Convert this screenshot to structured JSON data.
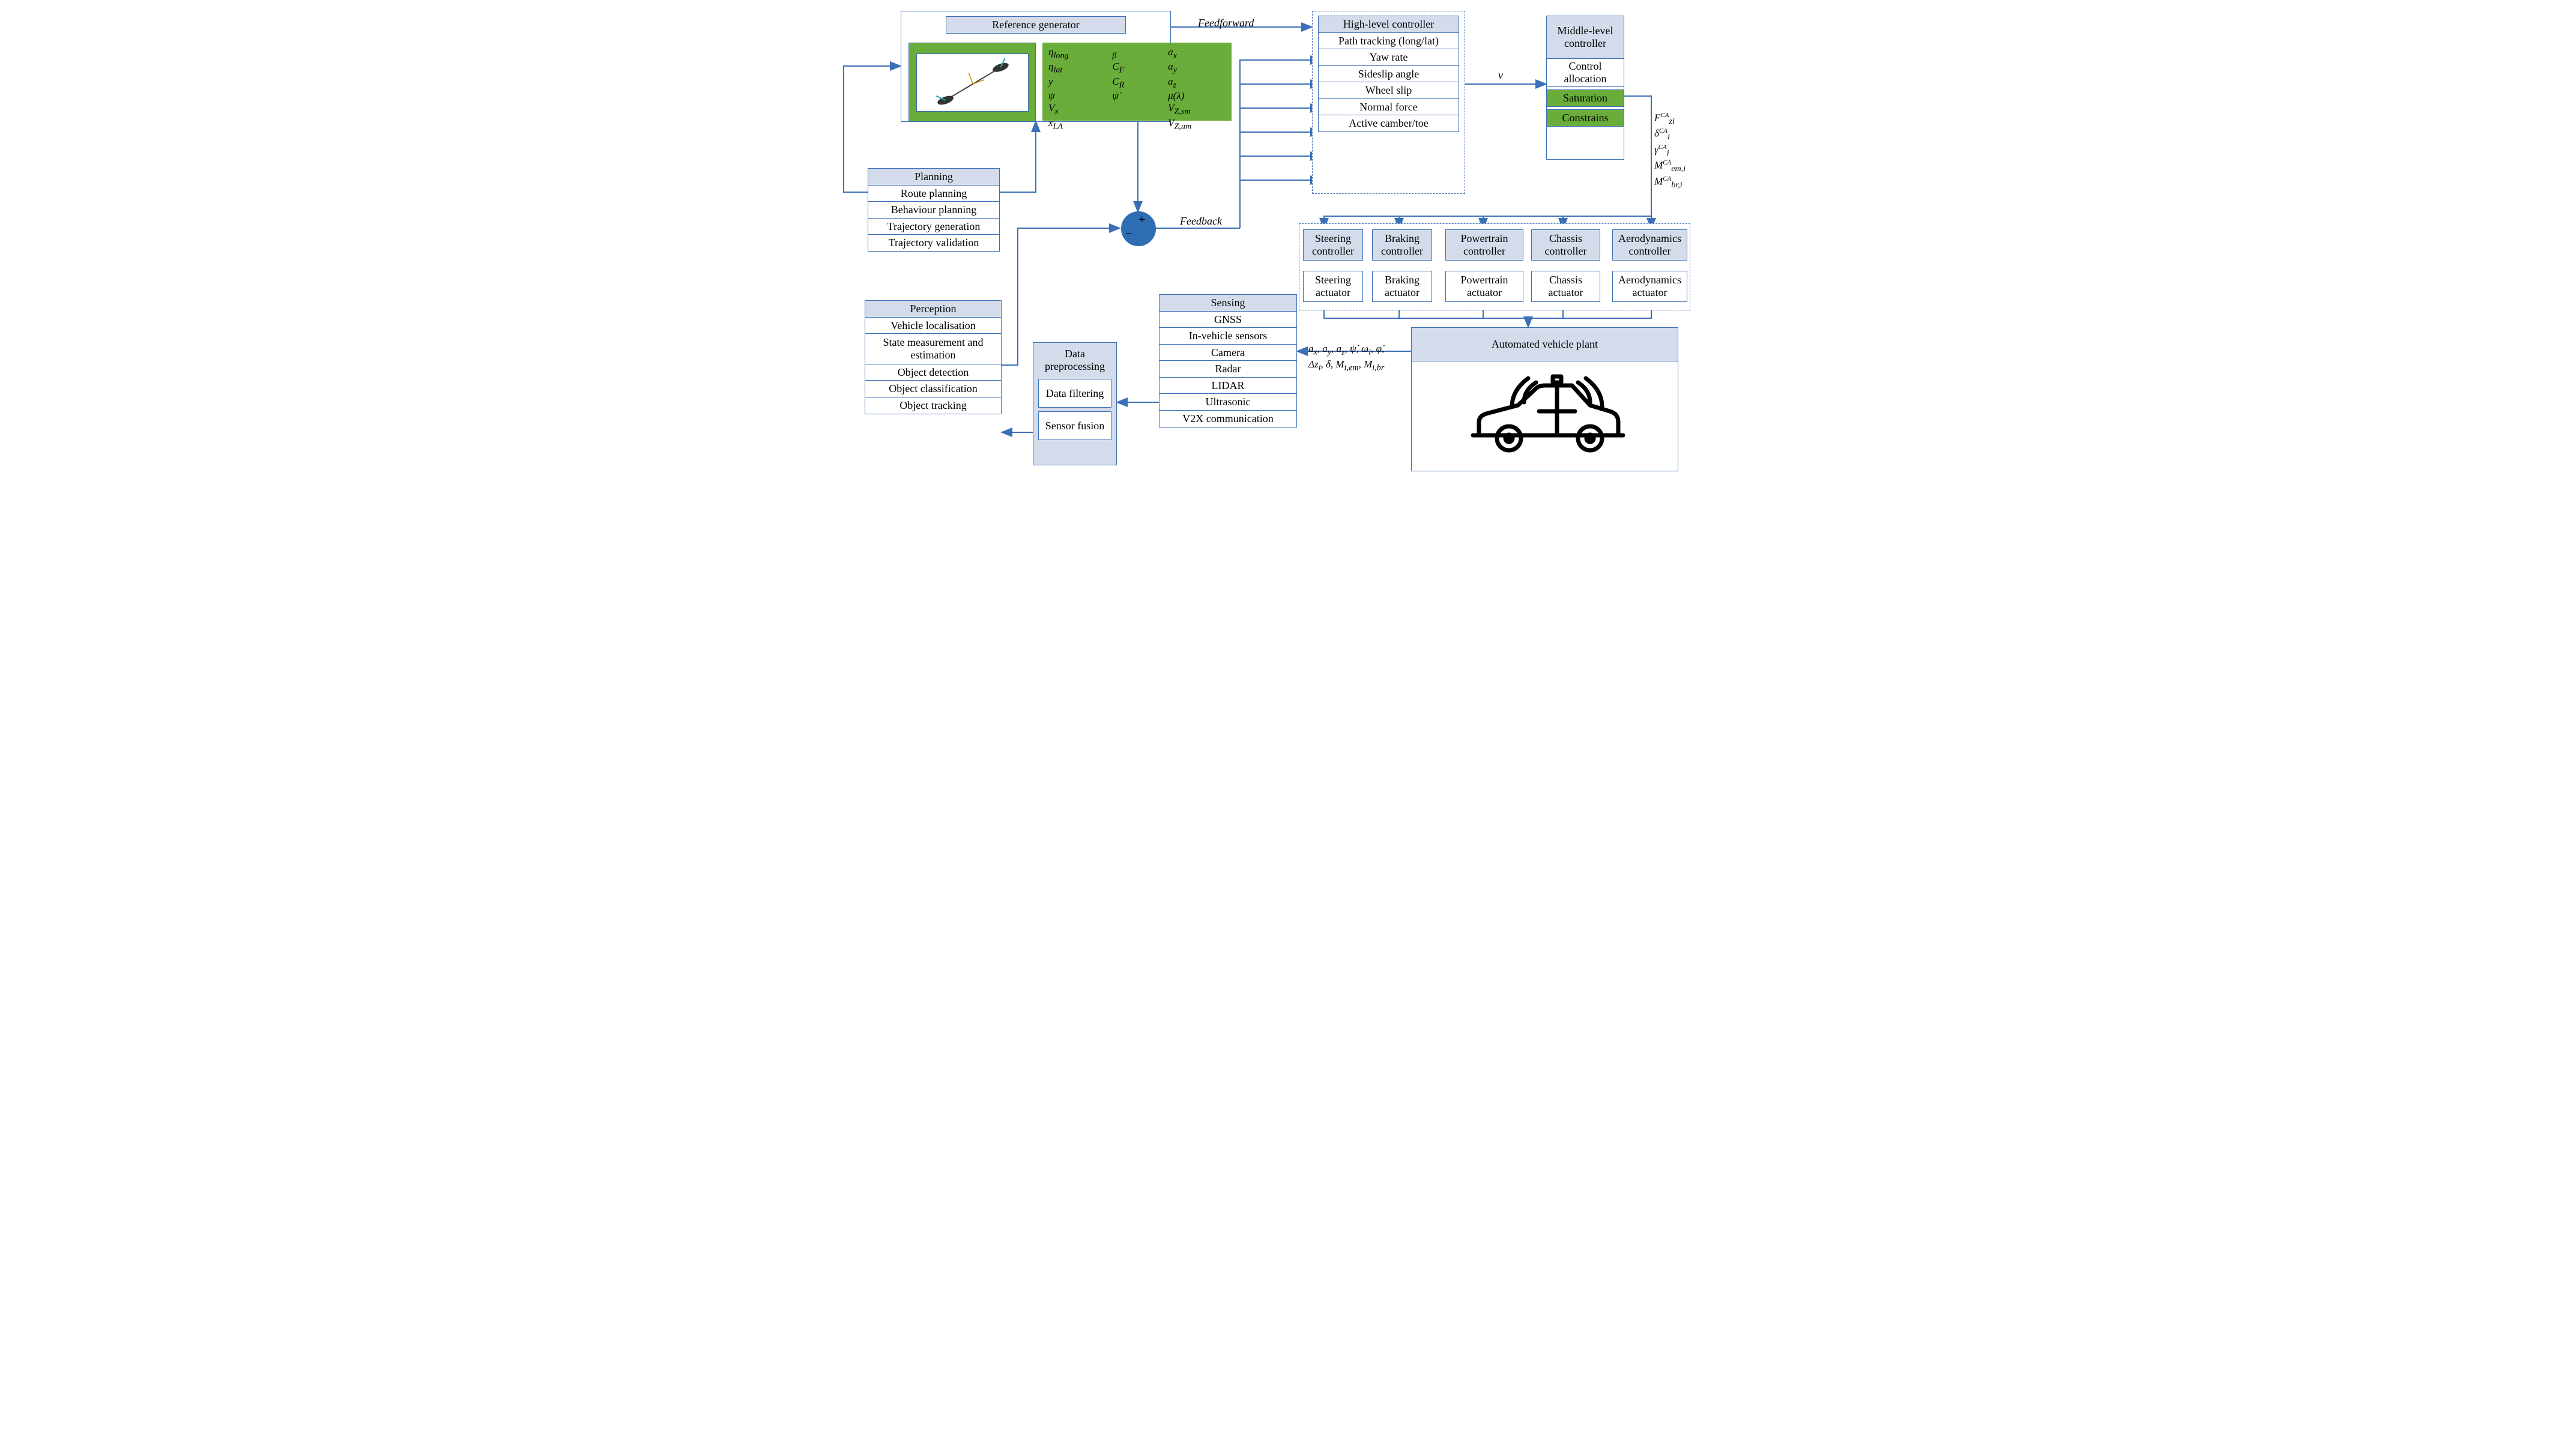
{
  "refgen": {
    "title": "Reference generator",
    "vars": [
      [
        "η",
        "long"
      ],
      [
        "η",
        "lat"
      ],
      [
        "y",
        ""
      ],
      [
        "ψ",
        ""
      ],
      [
        "V",
        "x"
      ],
      [
        "x",
        "LA"
      ],
      [
        "β",
        ""
      ],
      [
        "C",
        "F"
      ],
      [
        "C",
        "R"
      ],
      [
        "ψ̇",
        ""
      ],
      [
        "a",
        "x"
      ],
      [
        "a",
        "y"
      ],
      [
        "a",
        "z"
      ],
      [
        "μ(λ)",
        ""
      ],
      [
        "V",
        "Z,sm"
      ],
      [
        "V",
        "Z,um"
      ]
    ]
  },
  "planning": {
    "title": "Planning",
    "items": [
      "Route planning",
      "Behaviour planning",
      "Trajectory generation",
      "Trajectory validation"
    ]
  },
  "perception": {
    "title": "Perception",
    "items": [
      "Vehicle localisation",
      "State measurement and estimation",
      "Object detection",
      "Object classification",
      "Object tracking"
    ]
  },
  "preproc": {
    "title": "Data preprocessing",
    "items": [
      "Data filtering",
      "Sensor fusion"
    ]
  },
  "sensing": {
    "title": "Sensing",
    "items": [
      "GNSS",
      "In-vehicle sensors",
      "Camera",
      "Radar",
      "LIDAR",
      "Ultrasonic",
      "V2X communication"
    ]
  },
  "high": {
    "title": "High-level controller",
    "items": [
      "Path tracking (long/lat)",
      "Yaw rate",
      "Sideslip angle",
      "Wheel slip",
      "Normal force",
      "Active camber/toe"
    ]
  },
  "mid": {
    "title": "Middle-level controller",
    "items": [
      "Control allocation"
    ],
    "green": [
      "Saturation",
      "Constrains"
    ]
  },
  "low": {
    "controllers": [
      "Steering controller",
      "Braking controller",
      "Powertrain controller",
      "Chassis controller",
      "Aerodynamics controller"
    ],
    "actuators": [
      "Steering actuator",
      "Braking actuator",
      "Powertrain actuator",
      "Chassis actuator",
      "Aerodynamics actuator"
    ]
  },
  "plant": {
    "title": "Automated vehicle plant"
  },
  "labels": {
    "ff": "Feedforward",
    "fb": "Feedback",
    "v": "v"
  },
  "sensor_signals": "a_x, a_y, a_z, ψ̇, ω_i, φ̇,\nΔz_i, δ, M_{i,em}, M_{i,br}",
  "ca_outputs": [
    "F",
    "δ",
    "γ",
    "M",
    "M"
  ],
  "ca_sub": [
    "zi",
    "i",
    "i",
    "em,i",
    "br,i"
  ]
}
